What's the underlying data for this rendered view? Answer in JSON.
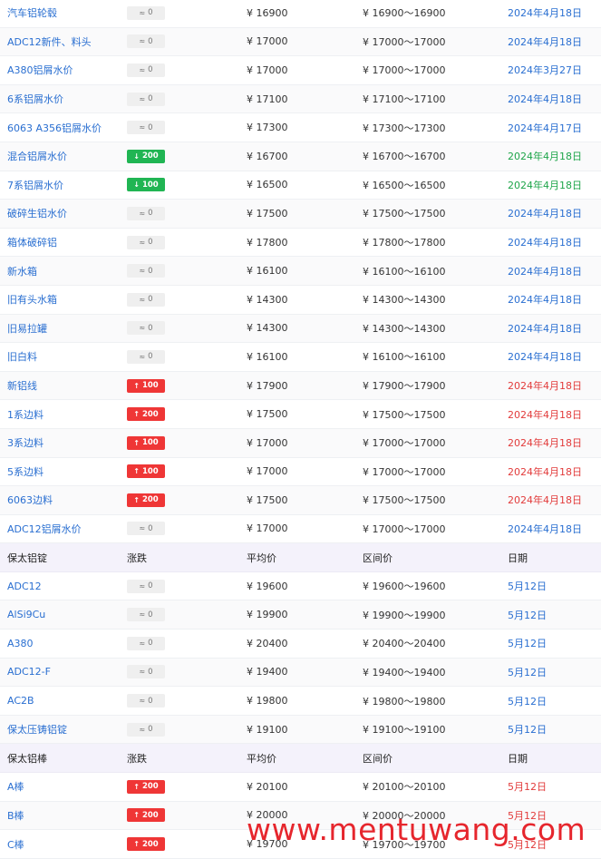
{
  "section1": {
    "rows": [
      {
        "name": "汽车铝轮毂",
        "change": "0",
        "dir": "flat",
        "avg": "¥ 16900",
        "range": "¥ 16900～16900",
        "date": "2024年4月18日",
        "date_color": "blue"
      },
      {
        "name": "ADC12新件、料头",
        "change": "0",
        "dir": "flat",
        "avg": "¥ 17000",
        "range": "¥ 17000～17000",
        "date": "2024年4月18日",
        "date_color": "blue"
      },
      {
        "name": "A380铝屑水价",
        "change": "0",
        "dir": "flat",
        "avg": "¥ 17000",
        "range": "¥ 17000～17000",
        "date": "2024年3月27日",
        "date_color": "blue"
      },
      {
        "name": "6系铝屑水价",
        "change": "0",
        "dir": "flat",
        "avg": "¥ 17100",
        "range": "¥ 17100～17100",
        "date": "2024年4月18日",
        "date_color": "blue"
      },
      {
        "name": "6063 A356铝屑水价",
        "change": "0",
        "dir": "flat",
        "avg": "¥ 17300",
        "range": "¥ 17300～17300",
        "date": "2024年4月17日",
        "date_color": "blue"
      },
      {
        "name": "混合铝屑水价",
        "change": "200",
        "dir": "down",
        "avg": "¥ 16700",
        "range": "¥ 16700～16700",
        "date": "2024年4月18日",
        "date_color": "green"
      },
      {
        "name": "7系铝屑水价",
        "change": "100",
        "dir": "down",
        "avg": "¥ 16500",
        "range": "¥ 16500～16500",
        "date": "2024年4月18日",
        "date_color": "green"
      },
      {
        "name": "破碎生铝水价",
        "change": "0",
        "dir": "flat",
        "avg": "¥ 17500",
        "range": "¥ 17500～17500",
        "date": "2024年4月18日",
        "date_color": "blue"
      },
      {
        "name": "箱体破碎铝",
        "change": "0",
        "dir": "flat",
        "avg": "¥ 17800",
        "range": "¥ 17800～17800",
        "date": "2024年4月18日",
        "date_color": "blue"
      },
      {
        "name": "新水箱",
        "change": "0",
        "dir": "flat",
        "avg": "¥ 16100",
        "range": "¥ 16100～16100",
        "date": "2024年4月18日",
        "date_color": "blue"
      },
      {
        "name": "旧有头水箱",
        "change": "0",
        "dir": "flat",
        "avg": "¥ 14300",
        "range": "¥ 14300～14300",
        "date": "2024年4月18日",
        "date_color": "blue"
      },
      {
        "name": "旧易拉罐",
        "change": "0",
        "dir": "flat",
        "avg": "¥ 14300",
        "range": "¥ 14300～14300",
        "date": "2024年4月18日",
        "date_color": "blue"
      },
      {
        "name": "旧白料",
        "change": "0",
        "dir": "flat",
        "avg": "¥ 16100",
        "range": "¥ 16100～16100",
        "date": "2024年4月18日",
        "date_color": "blue"
      },
      {
        "name": "新铝线",
        "change": "100",
        "dir": "up",
        "avg": "¥ 17900",
        "range": "¥ 17900～17900",
        "date": "2024年4月18日",
        "date_color": "red"
      },
      {
        "name": "1系边料",
        "change": "200",
        "dir": "up",
        "avg": "¥ 17500",
        "range": "¥ 17500～17500",
        "date": "2024年4月18日",
        "date_color": "red"
      },
      {
        "name": "3系边料",
        "change": "100",
        "dir": "up",
        "avg": "¥ 17000",
        "range": "¥ 17000～17000",
        "date": "2024年4月18日",
        "date_color": "red"
      },
      {
        "name": "5系边料",
        "change": "100",
        "dir": "up",
        "avg": "¥ 17000",
        "range": "¥ 17000～17000",
        "date": "2024年4月18日",
        "date_color": "red"
      },
      {
        "name": "6063边料",
        "change": "200",
        "dir": "up",
        "avg": "¥ 17500",
        "range": "¥ 17500～17500",
        "date": "2024年4月18日",
        "date_color": "red"
      },
      {
        "name": "ADC12铝屑水价",
        "change": "0",
        "dir": "flat",
        "avg": "¥ 17000",
        "range": "¥ 17000～17000",
        "date": "2024年4月18日",
        "date_color": "blue"
      }
    ]
  },
  "section2": {
    "header": {
      "name": "保太铝锭",
      "change": "涨跌",
      "avg": "平均价",
      "range": "区间价",
      "date": "日期"
    },
    "rows": [
      {
        "name": "ADC12",
        "change": "0",
        "dir": "flat",
        "avg": "¥ 19600",
        "range": "¥ 19600～19600",
        "date": "5月12日",
        "date_color": "blue"
      },
      {
        "name": "AlSi9Cu",
        "change": "0",
        "dir": "flat",
        "avg": "¥ 19900",
        "range": "¥ 19900～19900",
        "date": "5月12日",
        "date_color": "blue"
      },
      {
        "name": "A380",
        "change": "0",
        "dir": "flat",
        "avg": "¥ 20400",
        "range": "¥ 20400～20400",
        "date": "5月12日",
        "date_color": "blue"
      },
      {
        "name": "ADC12-F",
        "change": "0",
        "dir": "flat",
        "avg": "¥ 19400",
        "range": "¥ 19400～19400",
        "date": "5月12日",
        "date_color": "blue"
      },
      {
        "name": "AC2B",
        "change": "0",
        "dir": "flat",
        "avg": "¥ 19800",
        "range": "¥ 19800～19800",
        "date": "5月12日",
        "date_color": "blue"
      },
      {
        "name": "保太压铸铝锭",
        "change": "0",
        "dir": "flat",
        "avg": "¥ 19100",
        "range": "¥ 19100～19100",
        "date": "5月12日",
        "date_color": "blue"
      }
    ]
  },
  "section3": {
    "header": {
      "name": "保太铝棒",
      "change": "涨跌",
      "avg": "平均价",
      "range": "区间价",
      "date": "日期"
    },
    "rows": [
      {
        "name": "A棒",
        "change": "200",
        "dir": "up",
        "avg": "¥ 20100",
        "range": "¥ 20100～20100",
        "date": "5月12日",
        "date_color": "red"
      },
      {
        "name": "B棒",
        "change": "200",
        "dir": "up",
        "avg": "¥ 20000",
        "range": "¥ 20000～20000",
        "date": "5月12日",
        "date_color": "red"
      },
      {
        "name": "C棒",
        "change": "200",
        "dir": "up",
        "avg": "¥ 19700",
        "range": "¥ 19700～19700",
        "date": "5月12日",
        "date_color": "red"
      }
    ]
  },
  "icons": {
    "flat": "≈",
    "down": "↓",
    "up": "↑"
  },
  "watermark": {
    "text": "www.mentuwang.com",
    "color": "#e6262d"
  }
}
